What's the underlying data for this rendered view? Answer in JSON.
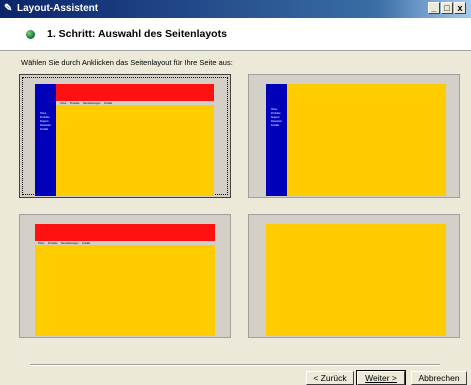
{
  "window": {
    "title": "Layout-Assistent",
    "controls": {
      "minimize": "_",
      "maximize": "□",
      "close": "x"
    }
  },
  "header": {
    "step_title": "1. Schritt: Auswahl des Seitenlayots"
  },
  "main": {
    "instruction": "Wählen Sie durch Anklicken das Seitenlayout für Ihre Seite aus:",
    "layouts": [
      {
        "id": "sidebar-and-topbar",
        "selected": true,
        "has_sidebar": true,
        "has_topbar": true,
        "nav_items": [
          "Home",
          "Produkte",
          "Support",
          "Download",
          "Kontakt"
        ],
        "menu_items": [
          "Home",
          "Produkte",
          "Dienstleistungen",
          "Kontakt"
        ]
      },
      {
        "id": "sidebar-only",
        "selected": false,
        "has_sidebar": true,
        "has_topbar": false,
        "nav_items": [
          "Home",
          "Produkte",
          "Support",
          "Download",
          "Kontakt"
        ]
      },
      {
        "id": "topbar-only",
        "selected": false,
        "has_sidebar": false,
        "has_topbar": true,
        "menu_items": [
          "Home",
          "Produkte",
          "Dienstleistungen",
          "Kontakt"
        ]
      },
      {
        "id": "content-only",
        "selected": false,
        "has_sidebar": false,
        "has_topbar": false
      }
    ],
    "colors": {
      "sidebar": "#0000b8",
      "topbar": "#ff1111",
      "content": "#ffcc00"
    }
  },
  "footer": {
    "back_label": "< Zurück",
    "next_label": "Weiter >",
    "cancel_label": "Abbrechen"
  }
}
